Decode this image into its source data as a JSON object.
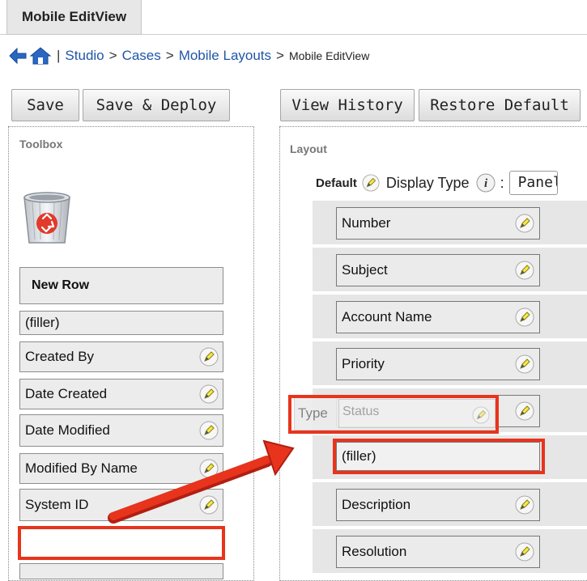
{
  "tab": {
    "label": "Mobile EditView"
  },
  "breadcrumb": {
    "items": [
      "Studio",
      "Cases",
      "Mobile Layouts"
    ],
    "current": "Mobile EditView",
    "separator_pipe": "|",
    "separator": ">"
  },
  "toolbar_left": {
    "save": "Save",
    "save_deploy": "Save & Deploy"
  },
  "toolbar_right": {
    "view_history": "View History",
    "restore_default": "Restore Default"
  },
  "toolbox": {
    "label": "Toolbox",
    "new_row": "New Row",
    "items": [
      "(filler)",
      "Created By",
      "Date Created",
      "Date Modified",
      "Modified By Name",
      "System ID"
    ]
  },
  "layout": {
    "label": "Layout",
    "default_label": "Default",
    "display_type_label": "Display Type",
    "colon": ":",
    "display_type_value": "Panel",
    "fields": [
      "Number",
      "Subject",
      "Account Name",
      "Priority"
    ],
    "drag_type": "Type",
    "drag_status": "Status",
    "filler": "(filler)",
    "fields_after": [
      "Description",
      "Resolution"
    ]
  },
  "colors": {
    "highlight": "#e8341c",
    "link": "#1f56a8"
  }
}
